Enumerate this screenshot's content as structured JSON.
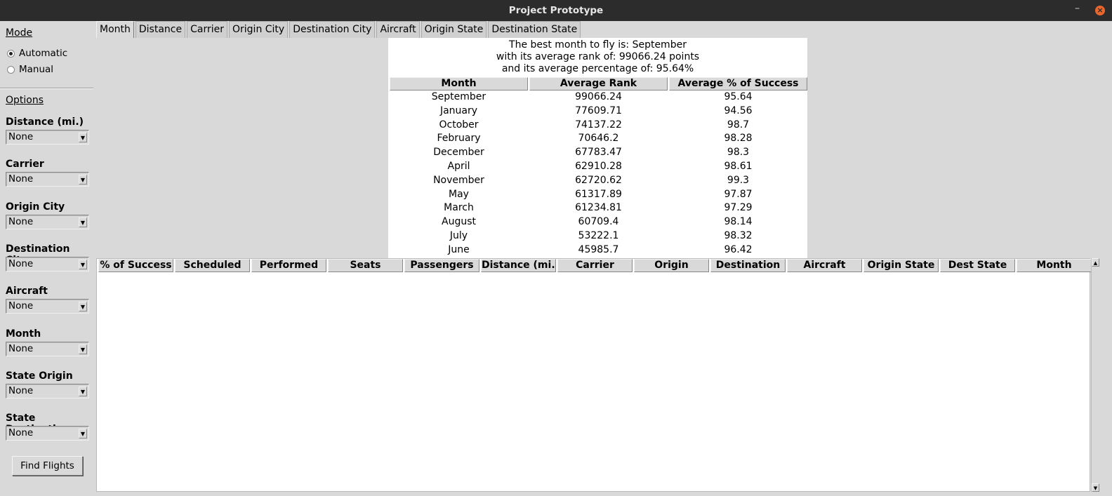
{
  "window": {
    "title": "Project Prototype"
  },
  "sidebar": {
    "mode_label": "Mode",
    "modes": [
      {
        "label": "Automatic",
        "selected": true
      },
      {
        "label": "Manual",
        "selected": false
      }
    ],
    "options_label": "Options",
    "filters": [
      {
        "label": "Distance (mi.)",
        "value": "None"
      },
      {
        "label": "Carrier",
        "value": "None"
      },
      {
        "label": "Origin City",
        "value": "None"
      },
      {
        "label": "Destination City",
        "value": "None"
      },
      {
        "label": "Aircraft",
        "value": "None"
      },
      {
        "label": "Month",
        "value": "None"
      },
      {
        "label": "State Origin",
        "value": "None"
      },
      {
        "label": "State Destination",
        "value": "None"
      }
    ],
    "find_button": "Find Flights"
  },
  "tabs": [
    {
      "label": "Month",
      "active": true
    },
    {
      "label": "Distance",
      "active": false
    },
    {
      "label": "Carrier",
      "active": false
    },
    {
      "label": "Origin City",
      "active": false
    },
    {
      "label": "Destination City",
      "active": false
    },
    {
      "label": "Aircraft",
      "active": false
    },
    {
      "label": "Origin State",
      "active": false
    },
    {
      "label": "Destination State",
      "active": false
    }
  ],
  "summary": {
    "line1": "The best month to fly is: September",
    "line2": "with its average rank of: 99066.24 points",
    "line3": "and its average percentage of: 95.64%",
    "columns": [
      "Month",
      "Average Rank",
      "Average % of Success"
    ],
    "rows": [
      [
        "September",
        "99066.24",
        "95.64"
      ],
      [
        "January",
        "77609.71",
        "94.56"
      ],
      [
        "October",
        "74137.22",
        "98.7"
      ],
      [
        "February",
        "70646.2",
        "98.28"
      ],
      [
        "December",
        "67783.47",
        "98.3"
      ],
      [
        "April",
        "62910.28",
        "98.61"
      ],
      [
        "November",
        "62720.62",
        "99.3"
      ],
      [
        "May",
        "61317.89",
        "97.87"
      ],
      [
        "March",
        "61234.81",
        "97.29"
      ],
      [
        "August",
        "60709.4",
        "98.14"
      ],
      [
        "July",
        "53222.1",
        "98.32"
      ],
      [
        "June",
        "45985.7",
        "96.42"
      ]
    ]
  },
  "results": {
    "columns": [
      "% of Success",
      "Scheduled",
      "Performed",
      "Seats",
      "Passengers",
      "Distance (mi.)",
      "Carrier",
      "Origin",
      "Destination",
      "Aircraft",
      "Origin State",
      "Dest State",
      "Month"
    ]
  }
}
